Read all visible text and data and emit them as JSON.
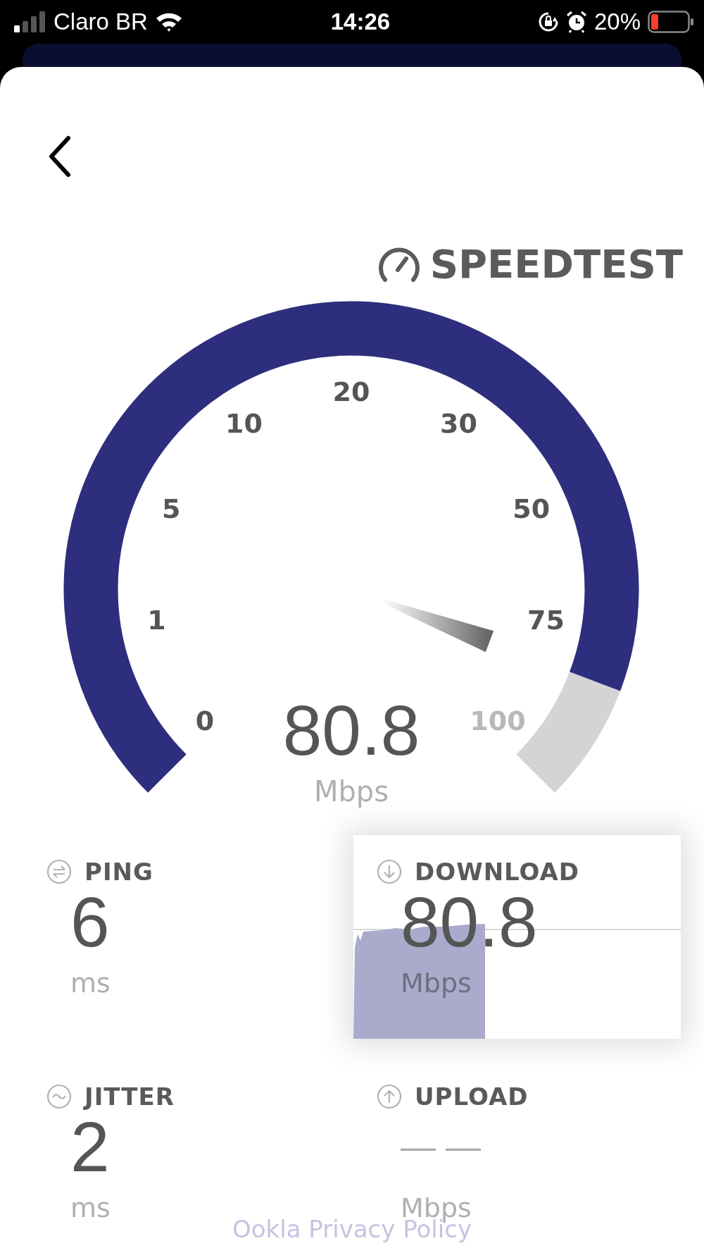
{
  "status_bar": {
    "carrier": "Claro BR",
    "time": "14:26",
    "battery": "20%"
  },
  "logo": {
    "text": "SPEEDTEST"
  },
  "gauge": {
    "reading": "80.8",
    "unit": "Mbps",
    "ticks": [
      {
        "label": "0",
        "passed": true
      },
      {
        "label": "1",
        "passed": true
      },
      {
        "label": "5",
        "passed": true
      },
      {
        "label": "10",
        "passed": true
      },
      {
        "label": "20",
        "passed": true
      },
      {
        "label": "30",
        "passed": true
      },
      {
        "label": "50",
        "passed": true
      },
      {
        "label": "75",
        "passed": true
      },
      {
        "label": "100",
        "passed": false
      }
    ]
  },
  "metrics": [
    {
      "kind": "ping",
      "label": "PING",
      "value": "6",
      "unit": "ms",
      "active": false
    },
    {
      "kind": "download",
      "label": "DOWNLOAD",
      "value": "80.8",
      "unit": "Mbps",
      "active": true
    },
    {
      "kind": "jitter",
      "label": "JITTER",
      "value": "2",
      "unit": "ms",
      "active": false
    },
    {
      "kind": "upload",
      "label": "UPLOAD",
      "value": "— —",
      "unit": "Mbps",
      "active": false
    }
  ],
  "footer": {
    "link": "Ookla Privacy Policy"
  }
}
